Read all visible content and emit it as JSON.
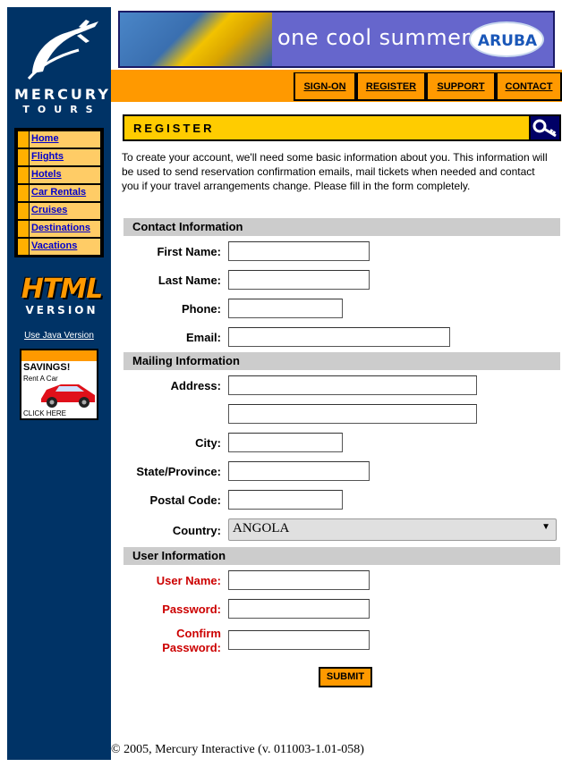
{
  "brand": {
    "name": "MERCURY",
    "sub": "TOURS"
  },
  "nav": {
    "items": [
      {
        "label": "Home"
      },
      {
        "label": "Flights"
      },
      {
        "label": "Hotels"
      },
      {
        "label": "Car Rentals"
      },
      {
        "label": "Cruises"
      },
      {
        "label": "Destinations"
      },
      {
        "label": "Vacations"
      }
    ]
  },
  "html_version": {
    "big": "HTML",
    "ver": "VERSION",
    "java_link": "Use Java Version"
  },
  "ad": {
    "title": "SAVINGS!",
    "sub": "Rent A Car",
    "click": "CLICK HERE"
  },
  "banner": {
    "slogan": "one cool summer",
    "logo_text": "ARUBA"
  },
  "topnav": {
    "signon": "SIGN-ON",
    "register": "REGISTER",
    "support": "SUPPORT",
    "contact": "CONTACT"
  },
  "register": {
    "title": "REGISTER",
    "intro": "To create your account, we'll need some basic information about you. This information will be used to send reservation confirmation emails, mail tickets when needed and contact you if your travel arrangements change. Please fill in the form completely."
  },
  "contact_section": {
    "heading": "Contact Information",
    "first_name": "First Name:",
    "last_name": "Last Name:",
    "phone": "Phone:",
    "email": "Email:"
  },
  "mailing_section": {
    "heading": "Mailing Information",
    "address": "Address:",
    "city": "City:",
    "state": "State/Province:",
    "postal": "Postal Code:",
    "country": "Country:",
    "country_value": "ANGOLA"
  },
  "user_section": {
    "heading": "User Information",
    "username": "User Name:",
    "password": "Password:",
    "confirm_1": "Confirm",
    "confirm_2": "Password:"
  },
  "submit_label": "SUBMIT",
  "footer": "© 2005, Mercury Interactive (v. 011003-1.01-058)",
  "colors": {
    "sidebar": "#003366",
    "accent_orange": "#FF9900",
    "register_yellow": "#FFCC00",
    "required_red": "#CC0000"
  }
}
